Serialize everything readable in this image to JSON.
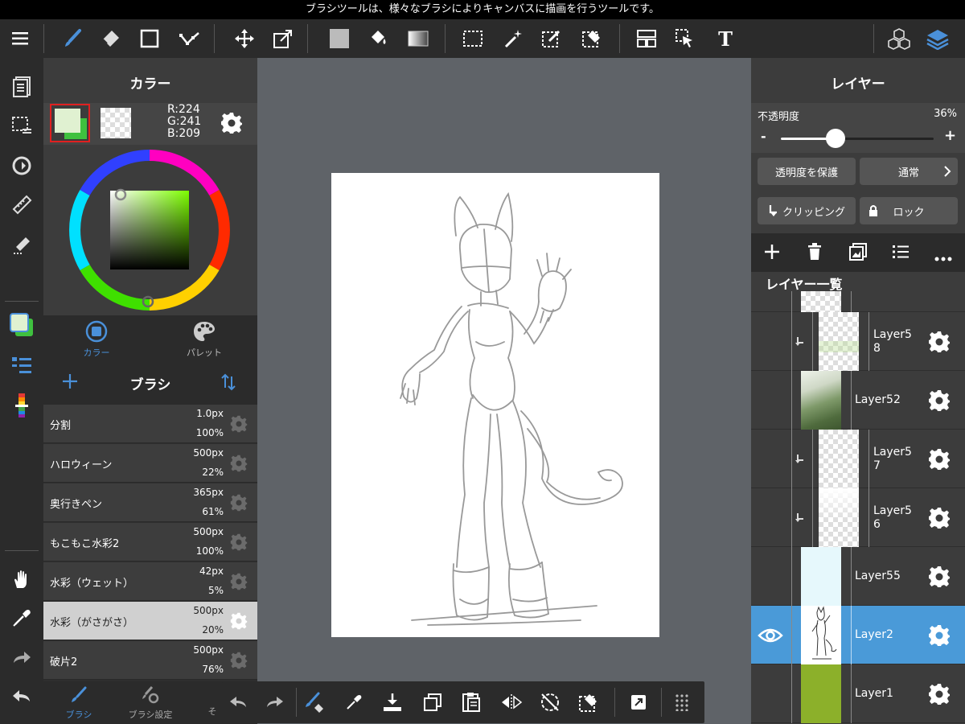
{
  "tooltip": "ブラシツールは、様々なブラシによりキャンバスに描画を行うツールです。",
  "colors": {
    "accent": "#4a90d9",
    "fg_color": "#e0f1d1",
    "selected_layer": "#4a9ad8"
  },
  "toolbar": {
    "icons": [
      "menu-icon",
      "brush-icon",
      "eraser-icon",
      "rectangle-icon",
      "dot-select-icon",
      "move-icon",
      "transform-icon",
      "fill-color-icon",
      "bucket-icon",
      "gradient-icon",
      "select-rect-icon",
      "magic-wand-icon",
      "select-pen-icon",
      "select-eraser-icon",
      "frame-icon",
      "pointer-icon",
      "text-icon",
      "3d-icon",
      "layers-icon"
    ],
    "text_tool": "T"
  },
  "color_panel": {
    "title": "カラー",
    "r": "R:224",
    "g": "G:241",
    "b": "B:209",
    "tabs": [
      {
        "label": "カラー",
        "active": true
      },
      {
        "label": "パレット",
        "active": false
      }
    ]
  },
  "brush_panel": {
    "title": "ブラシ",
    "brushes": [
      {
        "name": "分割",
        "size": "1.0px",
        "opacity": "100%",
        "selected": false
      },
      {
        "name": "ハロウィーン",
        "size": "500px",
        "opacity": "22%",
        "selected": false
      },
      {
        "name": "奥行きペン",
        "size": "365px",
        "opacity": "61%",
        "selected": false
      },
      {
        "name": "もこもこ水彩2",
        "size": "500px",
        "opacity": "100%",
        "selected": false
      },
      {
        "name": "水彩（ウェット）",
        "size": "42px",
        "opacity": "5%",
        "selected": false
      },
      {
        "name": "水彩（がさがさ）",
        "size": "500px",
        "opacity": "20%",
        "selected": true
      },
      {
        "name": "破片2",
        "size": "500px",
        "opacity": "76%",
        "selected": false
      }
    ],
    "bottom_tabs": [
      "ブラシ",
      "ブラシ設定",
      "そ"
    ]
  },
  "layer_panel": {
    "title": "レイヤー",
    "opacity_label": "不透明度",
    "opacity_value": "36%",
    "opacity": 0.36,
    "minus": "-",
    "plus": "+",
    "protect_alpha": "透明度を保護",
    "blend_mode": "通常",
    "clipping": "クリッピング",
    "lock": "ロック",
    "list_title": "レイヤー一覧",
    "layers": [
      {
        "name": "Layer5\n8",
        "clip": true,
        "thumb": "checker-green",
        "selected": false
      },
      {
        "name": "Layer52",
        "clip": false,
        "thumb": "foliage",
        "selected": false
      },
      {
        "name": "Layer5\n7",
        "clip": true,
        "thumb": "checker",
        "selected": false
      },
      {
        "name": "Layer5\n6",
        "clip": true,
        "thumb": "checker-fade",
        "selected": false
      },
      {
        "name": "Layer55",
        "clip": false,
        "thumb": "lightblue",
        "selected": false
      },
      {
        "name": "Layer2",
        "clip": false,
        "thumb": "sketch",
        "selected": true
      },
      {
        "name": "Layer1",
        "clip": false,
        "thumb": "green",
        "selected": false
      }
    ]
  }
}
